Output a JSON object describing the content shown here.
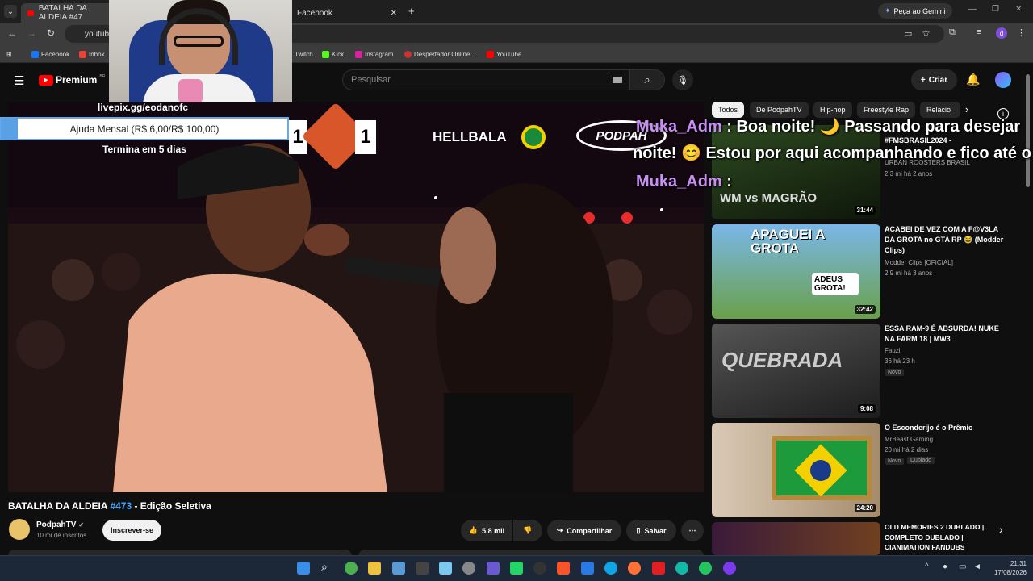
{
  "browser": {
    "tabs": [
      {
        "label": "BATALHA DA ALDEIA #47"
      },
      {
        "label": "Facebook"
      }
    ],
    "gemini_label": "Peça ao Gemini",
    "url": "youtub",
    "bookmarks": [
      "Facebook",
      "Inbox",
      "Twitch",
      "Kick",
      "Instagram",
      "Despertador Online...",
      "YouTube"
    ]
  },
  "header": {
    "brand": "Premium",
    "region": "BR",
    "search_placeholder": "Pesquisar",
    "create_label": "Criar"
  },
  "overlay": {
    "livepix": "livepix.gg/eodanofc",
    "goal_label": "Ajuda Mensal (R$ 6,00/R$ 100,00)",
    "goal_progress": 0.06,
    "goal_ends": "Termina em 5 dias",
    "chat": [
      {
        "user": "Muka_Adm",
        "text": ": Boa noite! 🌙 Passando para desejar"
      },
      {
        "user": "",
        "text": "noite! 😊 Estou por aqui acompanhando e fico até o"
      },
      {
        "user": "Muka_Adm",
        "text": ":"
      }
    ]
  },
  "video_overlay": {
    "score_left": "1",
    "score_right": "1",
    "event": "HELLBALA",
    "logo": "PODPAH"
  },
  "video": {
    "title_prefix": "BATALHA DA ALDEIA ",
    "title_tag": "#473",
    "title_suffix": " - Edição Seletiva",
    "channel": "PodpahTV",
    "subscribers": "10 mi de inscritos",
    "subscribe_label": "Inscrever-se",
    "likes": "5,8 mil",
    "share_label": "Compartilhar",
    "save_label": "Salvar"
  },
  "chips": [
    "Todos",
    "De PodpahTV",
    "Hip-hop",
    "Freestyle Rap",
    "Relacio"
  ],
  "recommendations": [
    {
      "title": "#FMSBRASIL2024 -",
      "channel": "URBAN ROOSTERS BRASIL",
      "meta": "2,3 mi   há 2 anos",
      "duration": "31:44",
      "thumb_text": "WM vs MAGRÃO"
    },
    {
      "title": "ACABEI DE VEZ COM A F@V3LA DA GROTA no GTA RP 😂 (Modder Clips)",
      "channel": "Modder Clips [OFICIAL]",
      "meta": "2,9 mi   há 3 anos",
      "duration": "32:42",
      "thumb_text": "APAGUEI A GROTA",
      "thumb_sub": "ADEUS GROTA!"
    },
    {
      "title": "ESSA RAM-9 É ABSURDA! NUKE NA FARM 18 | MW3",
      "channel": "Fauzi",
      "meta": "36   há 23 h",
      "duration": "9:08",
      "badge": "Novo",
      "thumb_text": "QUEBRADA"
    },
    {
      "title": "O Esconderijo é o Prêmio",
      "channel": "MrBeast Gaming",
      "meta": "20 mi   há 2 dias",
      "duration": "24:20",
      "badge": "Novo",
      "badge2": "Dublado"
    },
    {
      "title": "OLD MEMORIES 2 DUBLADO | COMPLETO DUBLADO | CIANIMATION FANDUBS",
      "channel": "",
      "meta": ""
    }
  ],
  "taskbar": {
    "time": "21:31",
    "date": "17/08/2026"
  }
}
